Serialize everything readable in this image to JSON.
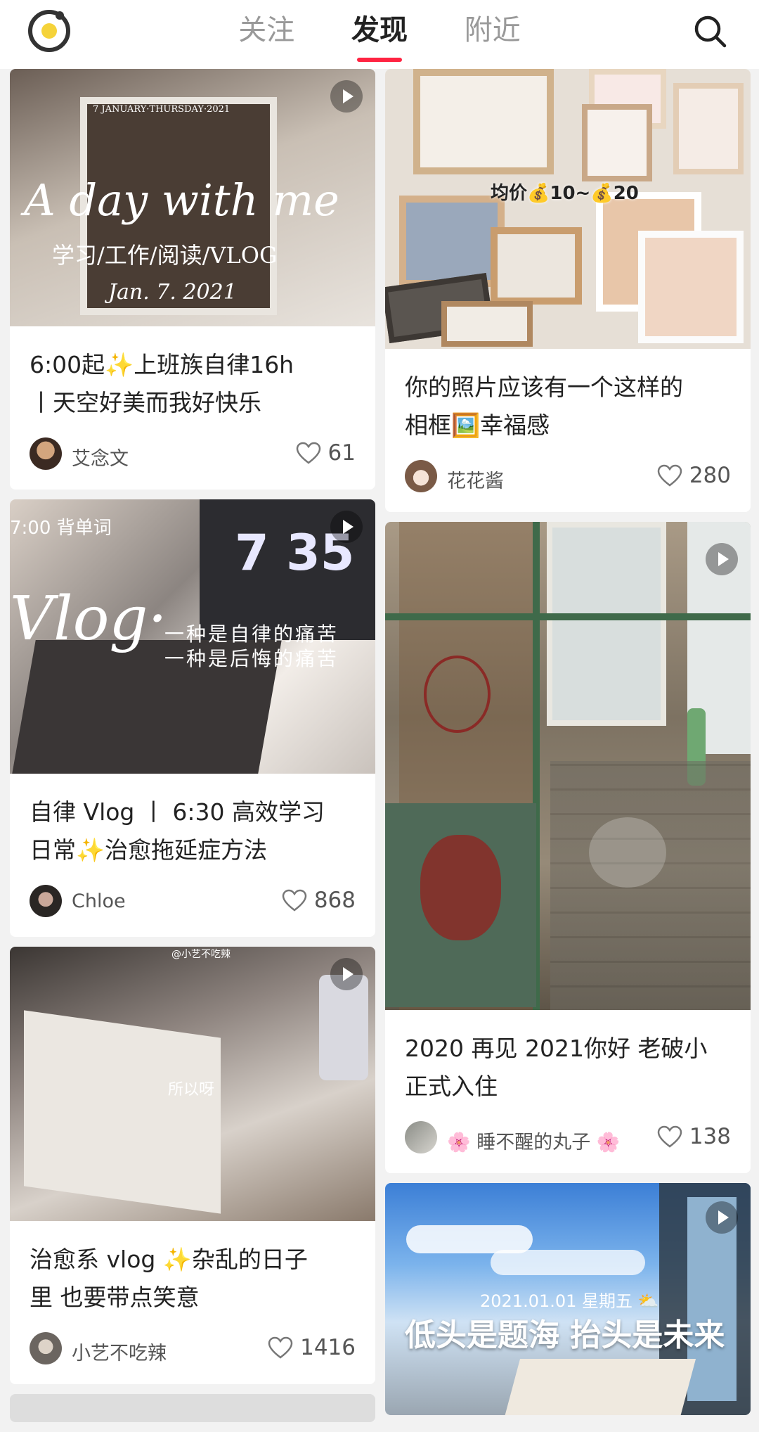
{
  "header": {
    "tabs": [
      {
        "label": "关注"
      },
      {
        "label": "发现"
      },
      {
        "label": "附近"
      }
    ]
  },
  "feed": {
    "left": [
      {
        "image_texts": [
          "7 JANUARY·THURSDAY·2021",
          "A day with me",
          "学习/工作/阅读/VLOG",
          "Jan. 7. 2021"
        ],
        "title_line1": "6:00起✨上班族自律16h",
        "title_line2": "丨天空好美而我好快乐",
        "author": "艾念文",
        "likes": "61"
      },
      {
        "image_texts": [
          "7:00 背单词",
          "7 35",
          "Vlog·",
          "一种是自律的痛苦",
          "一种是后悔的痛苦"
        ],
        "title_line1": "自律 Vlog 丨 6:30 高效学习",
        "title_line2": "日常✨治愈拖延症方法",
        "author": "Chloe",
        "likes": "868"
      },
      {
        "image_texts": [
          "@小艺不吃辣",
          "所以呀"
        ],
        "title_line1": "治愈系 vlog ✨杂乱的日子",
        "title_line2": "里 也要带点笑意",
        "author": "小艺不吃辣",
        "likes": "1416"
      }
    ],
    "right": [
      {
        "image_texts": [
          "均价💰10~💰20"
        ],
        "title_line1": "你的照片应该有一个这样的",
        "title_line2": "相框🖼️幸福感",
        "author": "花花酱",
        "likes": "280"
      },
      {
        "image_texts": [],
        "title_line1": "2020 再见 2021你好 老破小",
        "title_line2": "正式入住",
        "author": "🌸 睡不醒的丸子 🌸",
        "likes": "138"
      },
      {
        "image_texts": [
          "2021.01.01 星期五 ⛅",
          "低头是题海 抬头是未来"
        ]
      }
    ]
  },
  "colors": {
    "accent": "#ff2442",
    "logo_yellow": "#f5d33a"
  },
  "icons": [
    "logo-icon",
    "search-icon",
    "play-icon",
    "heart-icon"
  ]
}
